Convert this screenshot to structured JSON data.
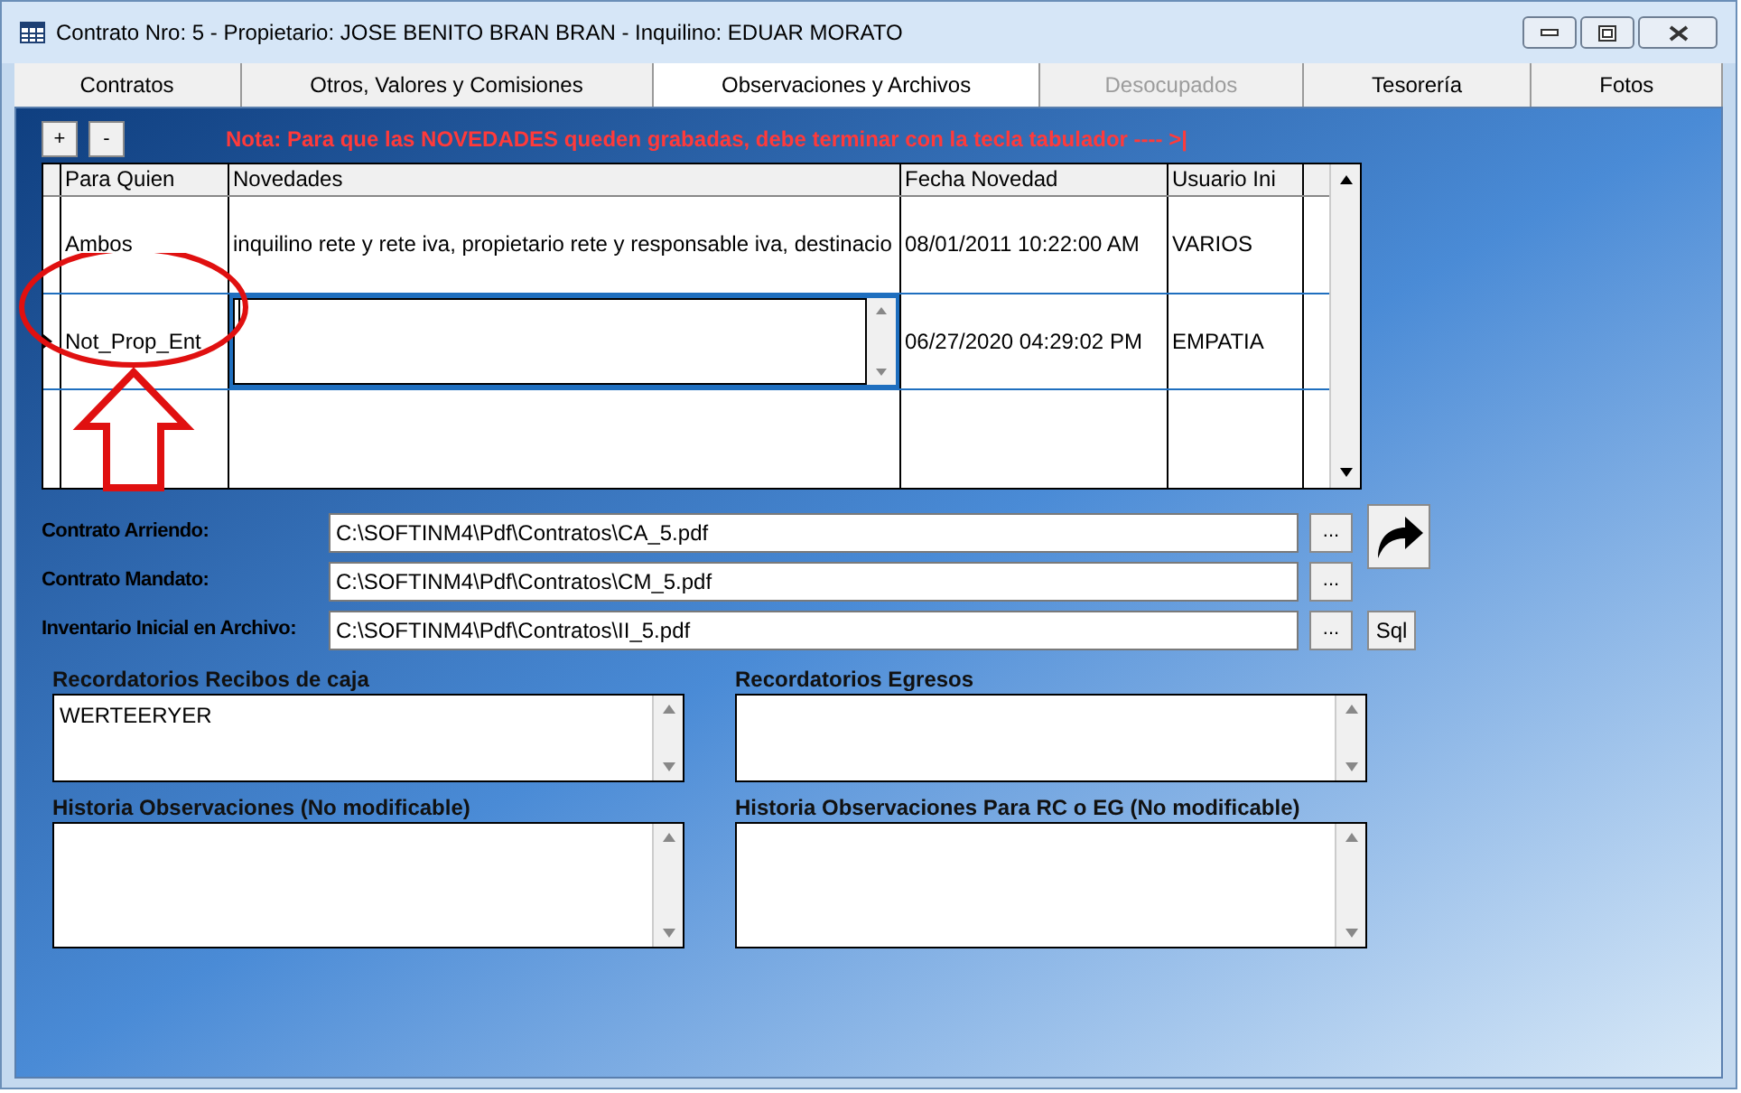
{
  "window": {
    "title": "Contrato Nro: 5 - Propietario: JOSE BENITO BRAN BRAN - Inquilino: EDUAR MORATO"
  },
  "tabs": [
    {
      "label": "Contratos",
      "selected": false,
      "disabled": false
    },
    {
      "label": "Otros, Valores y Comisiones",
      "selected": false,
      "disabled": false
    },
    {
      "label": "Observaciones y Archivos",
      "selected": true,
      "disabled": false
    },
    {
      "label": "Desocupados",
      "selected": false,
      "disabled": true
    },
    {
      "label": "Tesorería",
      "selected": false,
      "disabled": false
    },
    {
      "label": "Fotos",
      "selected": false,
      "disabled": false
    }
  ],
  "toolbar": {
    "buttons": [
      "+",
      "-"
    ],
    "note": "Nota: Para que las NOVEDADES queden grabadas, debe terminar con la tecla tabulador ---- >|"
  },
  "grid": {
    "columns": [
      "Para Quien",
      "Novedades",
      "Fecha Novedad",
      "Usuario Ini"
    ],
    "rows": [
      {
        "para_quien": "Ambos",
        "novedades": "inquilino rete y rete iva, propietario rete y responsable iva, destinacio",
        "fecha": "08/01/2011 10:22:00 AM",
        "usuario": "VARIOS",
        "current": false,
        "editing": false
      },
      {
        "para_quien": "Not_Prop_Ent",
        "novedades": "",
        "fecha": "06/27/2020 04:29:02 PM",
        "usuario": "EMPATIA",
        "current": true,
        "editing": true
      }
    ]
  },
  "files": [
    {
      "label": "Contrato Arriendo:",
      "value": "C:\\SOFTINM4\\Pdf\\Contratos\\CA_5.pdf",
      "browse": "...",
      "kind": "arrow"
    },
    {
      "label": "Contrato Mandato:",
      "value": "C:\\SOFTINM4\\Pdf\\Contratos\\CM_5.pdf",
      "browse": "...",
      "kind": "plain"
    },
    {
      "label": "Inventario Inicial en Archivo:",
      "value": "C:\\SOFTINM4\\Pdf\\Contratos\\II_5.pdf",
      "browse": "...",
      "kind": "sql",
      "extra_label": "Sql"
    }
  ],
  "memos": [
    {
      "label": "Recordatorios Recibos de caja",
      "value": "WERTEERYER"
    },
    {
      "label": "Recordatorios Egresos"
    },
    {
      "label": "Historia Observaciones (No modificable)"
    },
    {
      "label": "Historia Observaciones Para RC o EG (No modificable)"
    }
  ],
  "annotation": {
    "shown": true
  }
}
